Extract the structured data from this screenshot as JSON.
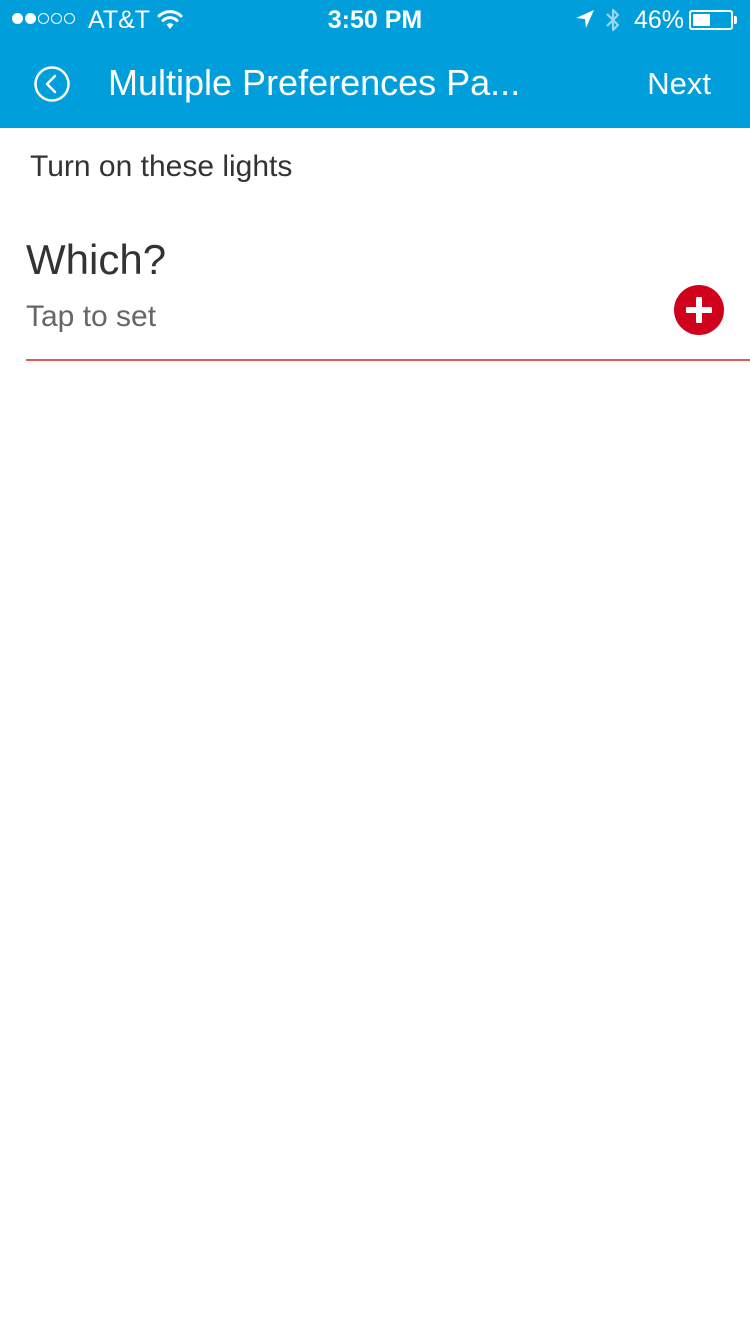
{
  "colors": {
    "accent": "#009fdb",
    "danger": "#d0021b"
  },
  "status_bar": {
    "carrier": "AT&T",
    "signal_bars_filled": 2,
    "signal_bars_total": 5,
    "time": "3:50 PM",
    "battery_percent_text": "46%",
    "battery_level": 0.46
  },
  "nav": {
    "title": "Multiple Preferences Pa...",
    "next_label": "Next"
  },
  "content": {
    "section_label": "Turn on these lights",
    "preference": {
      "label": "Which?",
      "placeholder": "Tap to set"
    }
  },
  "icons": [
    "back-chevron-icon",
    "wifi-icon",
    "location-arrow-icon",
    "bluetooth-icon",
    "battery-icon",
    "add-icon"
  ]
}
